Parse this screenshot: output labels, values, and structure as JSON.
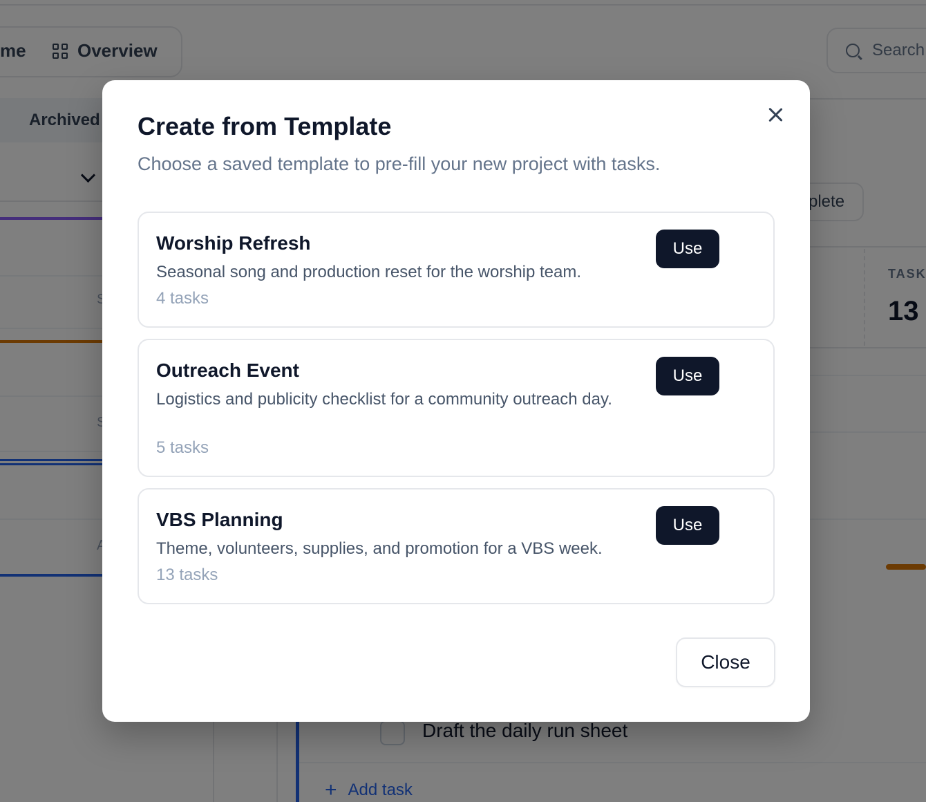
{
  "background": {
    "nav": {
      "prev_label": "me",
      "overview_label": "Overview"
    },
    "search": {
      "placeholder": "Search"
    },
    "tabs": {
      "archived_label": "Archived"
    },
    "rows_letters": [
      "S",
      "S",
      "A"
    ],
    "complete_label": "plete",
    "stats": {
      "label": "TASK",
      "value": "13"
    },
    "task": {
      "title": "Draft the daily run sheet"
    },
    "add_task_label": "Add task",
    "colors": {
      "purple": "#8b5cf6",
      "amber": "#d97706",
      "blue": "#2563eb"
    }
  },
  "modal": {
    "title": "Create from Template",
    "subtitle": "Choose a saved template to pre-fill your new project with tasks.",
    "templates": [
      {
        "name": "Worship Refresh",
        "description": "Seasonal song and production reset for the worship team.",
        "count": "4 tasks",
        "action": "Use"
      },
      {
        "name": "Outreach Event",
        "description": "Logistics and publicity checklist for a community outreach day.",
        "count": "5 tasks",
        "action": "Use"
      },
      {
        "name": "VBS Planning",
        "description": "Theme, volunteers, supplies, and promotion for a VBS week.",
        "count": "13 tasks",
        "action": "Use"
      }
    ],
    "close_label": "Close"
  }
}
